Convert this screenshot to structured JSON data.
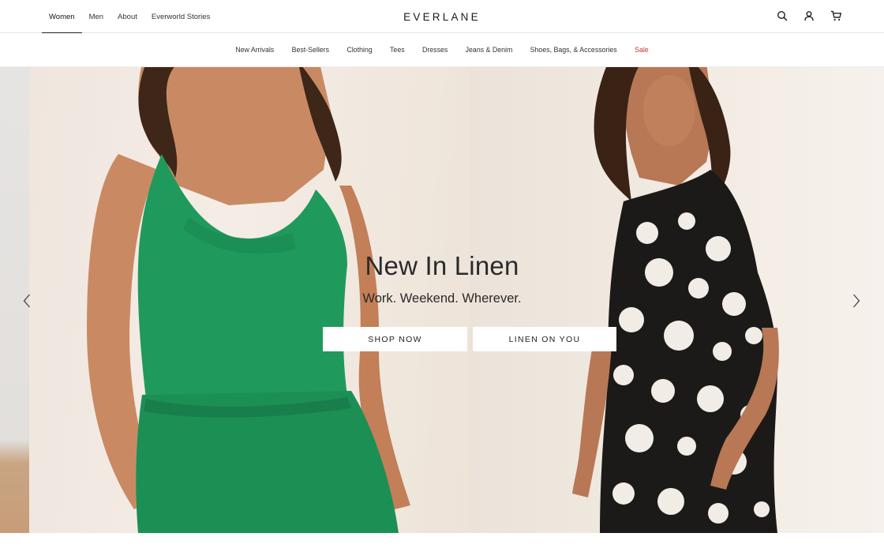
{
  "header": {
    "top_nav": [
      {
        "label": "Women",
        "active": true
      },
      {
        "label": "Men",
        "active": false
      },
      {
        "label": "About",
        "active": false
      },
      {
        "label": "Everworld Stories",
        "active": false
      }
    ],
    "logo": "EVERLANE",
    "icons": [
      "search-icon",
      "account-icon",
      "cart-icon"
    ]
  },
  "category_nav": [
    {
      "label": "New Arrivals"
    },
    {
      "label": "Best-Sellers"
    },
    {
      "label": "Clothing"
    },
    {
      "label": "Tees"
    },
    {
      "label": "Dresses"
    },
    {
      "label": "Jeans & Denim"
    },
    {
      "label": "Shoes, Bags, & Accessories"
    },
    {
      "label": "Sale"
    }
  ],
  "hero": {
    "title": "New In Linen",
    "subtitle": "Work. Weekend. Wherever.",
    "buttons": {
      "shop_now": "SHOP NOW",
      "linen_on_you": "LINEN ON YOU"
    },
    "prev_icon": "chevron-left-icon",
    "next_icon": "chevron-right-icon"
  },
  "colors": {
    "sale": "#c4382c",
    "text": "#262626",
    "linen_green": "#1f9a5c"
  }
}
